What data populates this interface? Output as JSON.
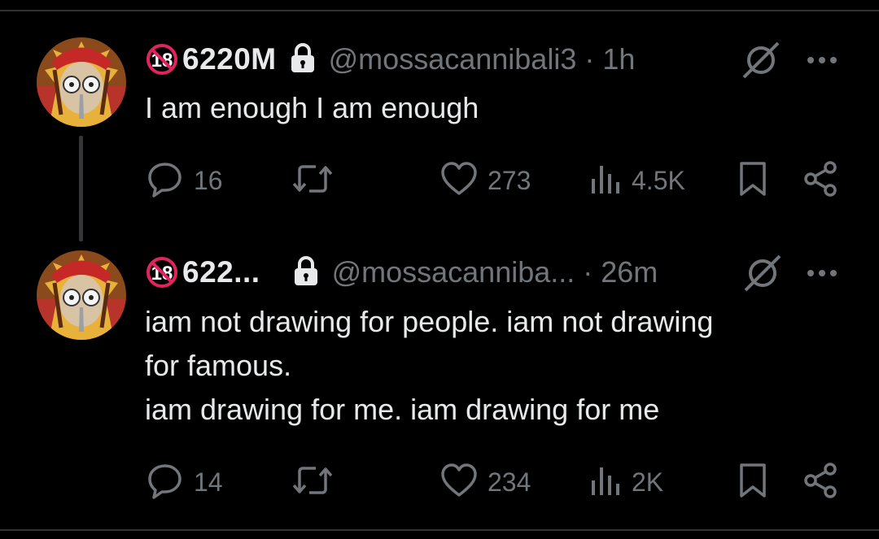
{
  "tweets": [
    {
      "display_name": "6220M",
      "handle": "@mossacannibali3",
      "separator": "·",
      "time": "1h",
      "text_lines": [
        "I am enough I am enough"
      ],
      "replies": "16",
      "retweets": "",
      "likes": "273",
      "views": "4.5K"
    },
    {
      "display_name": "622...",
      "handle": "@mossacanniba...",
      "separator": "·",
      "time": "26m",
      "text_lines": [
        "iam not drawing for people. iam not drawing",
        "for famous.",
        "iam drawing for me. iam drawing for me"
      ],
      "replies": "14",
      "retweets": "",
      "likes": "234",
      "views": "2K"
    }
  ],
  "badge": {
    "label": "18",
    "color": "#e0245e"
  },
  "icons": [
    "badge-18-icon",
    "lock-icon",
    "grok-icon",
    "more-icon",
    "reply-icon",
    "retweet-icon",
    "like-icon",
    "views-icon",
    "bookmark-icon",
    "share-icon"
  ],
  "colors": {
    "background": "#000000",
    "text": "#e7e9ea",
    "secondary": "#71767b",
    "divider": "#2f3336"
  }
}
